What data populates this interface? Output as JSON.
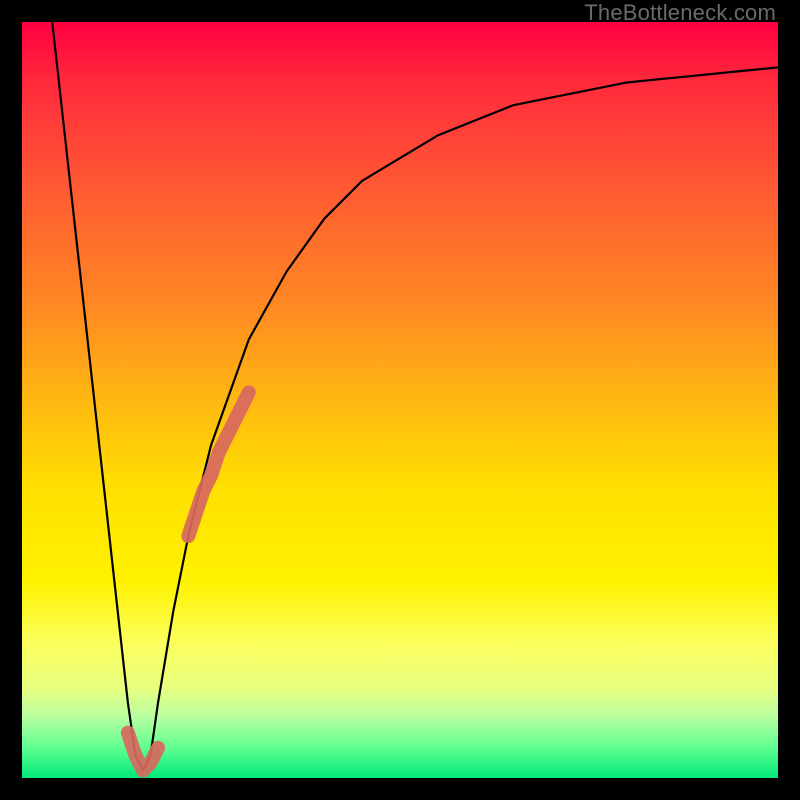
{
  "watermark": "TheBottleneck.com",
  "colors": {
    "frame": "#000000",
    "curve": "#000000",
    "highlight": "#d86860"
  },
  "chart_data": {
    "type": "line",
    "title": "",
    "xlabel": "",
    "ylabel": "",
    "xlim": [
      0,
      100
    ],
    "ylim": [
      0,
      100
    ],
    "grid": false,
    "legend": false,
    "series": [
      {
        "name": "bottleneck-curve",
        "color": "#000000",
        "x": [
          4,
          6,
          8,
          10,
          11,
          12,
          13,
          14,
          15,
          16,
          17,
          18,
          20,
          22,
          25,
          30,
          35,
          40,
          45,
          50,
          55,
          60,
          65,
          70,
          75,
          80,
          85,
          90,
          95,
          100
        ],
        "y": [
          100,
          82,
          64,
          46,
          37,
          28,
          19,
          10,
          3,
          1,
          3,
          10,
          22,
          32,
          44,
          58,
          67,
          74,
          79,
          82,
          85,
          87,
          89,
          90,
          91,
          92,
          92.5,
          93,
          93.5,
          94
        ]
      }
    ],
    "highlights": [
      {
        "name": "segment-right",
        "color": "#d86860",
        "thickness": 14,
        "x": [
          22,
          23,
          24,
          25,
          26,
          27,
          28,
          29,
          30
        ],
        "y": [
          32,
          35,
          38,
          40,
          43,
          45,
          47,
          49,
          51
        ]
      },
      {
        "name": "segment-bottom",
        "color": "#d86860",
        "thickness": 14,
        "x": [
          14,
          15,
          16,
          17,
          18
        ],
        "y": [
          6,
          3,
          1,
          2,
          4
        ]
      }
    ]
  }
}
